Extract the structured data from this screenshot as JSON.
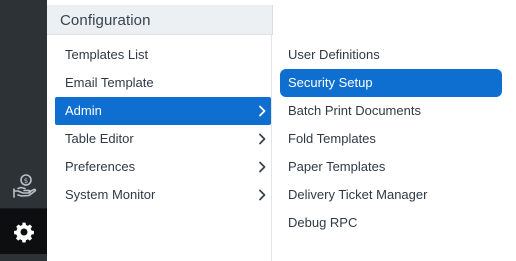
{
  "colors": {
    "sidebar_bg": "#2d3236",
    "accent": "#0f6fd1",
    "header_bg": "#ecf0f3",
    "text": "#2f3a45"
  },
  "sidebar": {
    "items": [
      {
        "icon": "hand-coin-icon"
      },
      {
        "icon": "gear-icon",
        "active": true
      }
    ]
  },
  "menu": {
    "title": "Configuration",
    "items": [
      {
        "label": "Templates List",
        "has_submenu": false
      },
      {
        "label": "Email Template",
        "has_submenu": false
      },
      {
        "label": "Admin",
        "has_submenu": true,
        "active": true
      },
      {
        "label": "Table Editor",
        "has_submenu": true
      },
      {
        "label": "Preferences",
        "has_submenu": true
      },
      {
        "label": "System Monitor",
        "has_submenu": true
      }
    ]
  },
  "submenu": {
    "items": [
      {
        "label": "User Definitions"
      },
      {
        "label": "Security Setup",
        "active": true
      },
      {
        "label": "Batch Print Documents"
      },
      {
        "label": "Fold Templates"
      },
      {
        "label": "Paper Templates"
      },
      {
        "label": "Delivery Ticket Manager"
      },
      {
        "label": "Debug RPC"
      }
    ]
  }
}
